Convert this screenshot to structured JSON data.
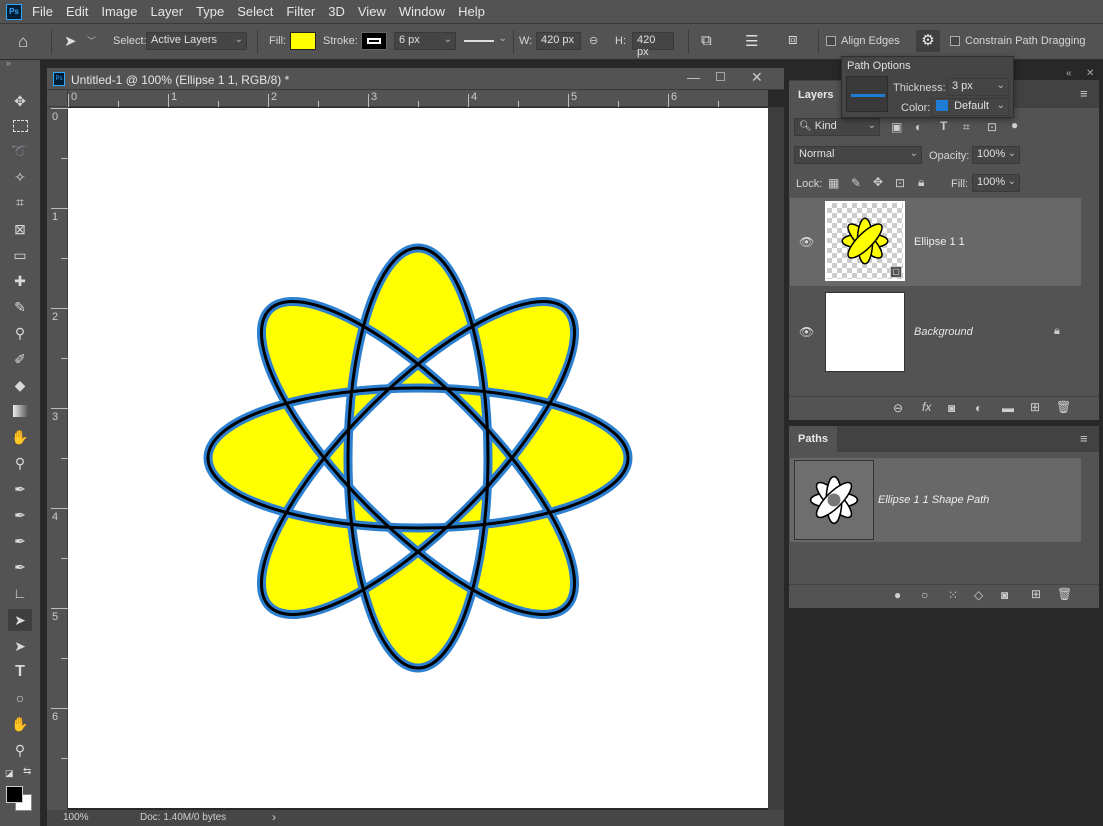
{
  "menubar": {
    "logo": "Ps",
    "items": [
      "File",
      "Edit",
      "Image",
      "Layer",
      "Type",
      "Select",
      "Filter",
      "3D",
      "View",
      "Window",
      "Help"
    ]
  },
  "options": {
    "select_label": "Select:",
    "select_value": "Active Layers",
    "fill_label": "Fill:",
    "fill_color": "#ffff00",
    "stroke_label": "Stroke:",
    "stroke_width": "6 px",
    "w_label": "W:",
    "w_value": "420 px",
    "h_label": "H:",
    "h_value": "420 px",
    "align_edges": "Align Edges",
    "constrain": "Constrain Path Dragging"
  },
  "path_options": {
    "title": "Path Options",
    "thickness_label": "Thickness:",
    "thickness_value": "3 px",
    "color_label": "Color:",
    "color_value": "Default",
    "color_swatch": "#1e7bd6"
  },
  "document": {
    "title": "Untitled-1 @ 100% (Ellipse 1 1, RGB/8) *",
    "ruler_h": [
      "0",
      "1",
      "2",
      "3",
      "4",
      "5",
      "6"
    ],
    "ruler_v": [
      "0",
      "1",
      "2",
      "3",
      "4",
      "5",
      "6"
    ],
    "zoom": "100%",
    "doc_info": "Doc: 1.40M/0 bytes",
    "shape": {
      "fill": "#ffff00",
      "stroke": "#000000",
      "path_color": "#2d7fd0"
    }
  },
  "layers_panel": {
    "tab": "Layers",
    "filter_kind": "Kind",
    "blend_mode": "Normal",
    "opacity_label": "Opacity:",
    "opacity_value": "100%",
    "lock_label": "Lock:",
    "fill_label": "Fill:",
    "fill_value": "100%",
    "layers": [
      {
        "name": "Ellipse 1 1",
        "selected": true
      },
      {
        "name": "Background",
        "selected": false
      }
    ]
  },
  "paths_panel": {
    "tab": "Paths",
    "paths": [
      {
        "name": "Ellipse 1 1 Shape Path"
      }
    ]
  }
}
